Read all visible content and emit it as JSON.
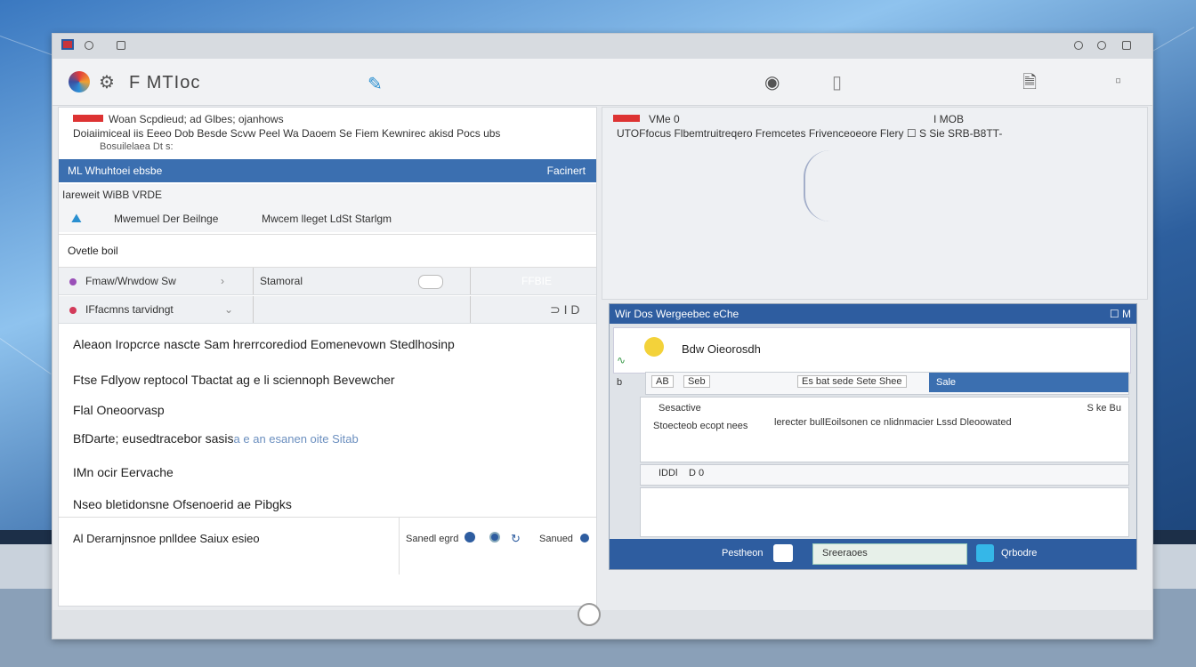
{
  "app": {
    "title": "F MTIoc"
  },
  "left": {
    "info_line1": "Woan Scpdieud; ad Glbes; ojanhows",
    "info_line2": "Doiaiimiceal iis Eeeo Dob Besde Scvw Peel Wa Daoem Se Fiem Kewnirec akisd Pocs ubs",
    "info_line3": "Bosuilelaea Dt s:",
    "header_label": "ML Whuhtoei ebsbe",
    "header_right": "Facinert",
    "sub_label": "Iareweit WiBB VRDE",
    "sub_left": "Mwemuel Der Beilnge",
    "sub_right": "Mwcem lleget LdSt Starlgm",
    "field_label": "Ovetle boil",
    "row1_label": "Fmaw/Wrwdow Sw",
    "row1_mid": "Stamoral",
    "row1_right": "FFBIE",
    "row2_label": "IFfacmns tarvidngt",
    "row2_right": "⊃ I D",
    "list": [
      "Aleaon Iropcrce nascte Sam hrerrcorediod Eomenevown Stedlhosinp",
      "Ftse Fdlyow reptocol Tbactat ag e li sciennoph Bevewcher",
      "Flal Oneoorvasp",
      "BfDarte; eusedtracebor sasis",
      "IMn ocir Eervache",
      "Nseo bletidonsne Ofsenoerid ae Pibgks"
    ],
    "list4_faint": "a e an esanen oite Sitab",
    "footer_label": "Al Derarnjnsnoe pnlldee Saiux esieo",
    "footer_link1": "Sanedl egrd",
    "footer_link2": "Sanued"
  },
  "right": {
    "info_line1": "VMe 0",
    "info_line1_right": "I MOB",
    "info_line2": "UTOFfocus Flbemtruitreqero Fremcetes Frivenceoeore Flery ☐ S Sie SRB-B8TT-",
    "subwindow": {
      "title": "Wir Dos Wergeebec eChe",
      "title_right": "☐ M",
      "card_title": "Bdw Oieorosdh",
      "row1_a": "AB",
      "row1_b": "Seb",
      "row1_c": "Es bat sede Sete Shee",
      "row1_blue": "Sale",
      "panel_label": "Sesactive",
      "panel_right": "S ke Bu",
      "panel_text1": "Stoecteob ecopt nees",
      "panel_text2": "lerecter bullEoilsonen ce nlidnmacier Lssd Dleoowated",
      "row2_a": "IDDl",
      "row2_b": "D 0",
      "bottom_left": "Pestheon",
      "bottom_input": "Sreeraoes",
      "bottom_right": "Qrbodre"
    }
  },
  "colors": {
    "accent": "#3b6fb0",
    "accent_dark": "#2e5da0",
    "desktop": "#3a78c0"
  },
  "icons": {
    "app_logo": "colorful-app-logo",
    "settings": "gear-icon",
    "puzzle": "puzzle-icon",
    "camera": "camera-icon",
    "document": "document-icon",
    "home": "home-button-icon"
  }
}
